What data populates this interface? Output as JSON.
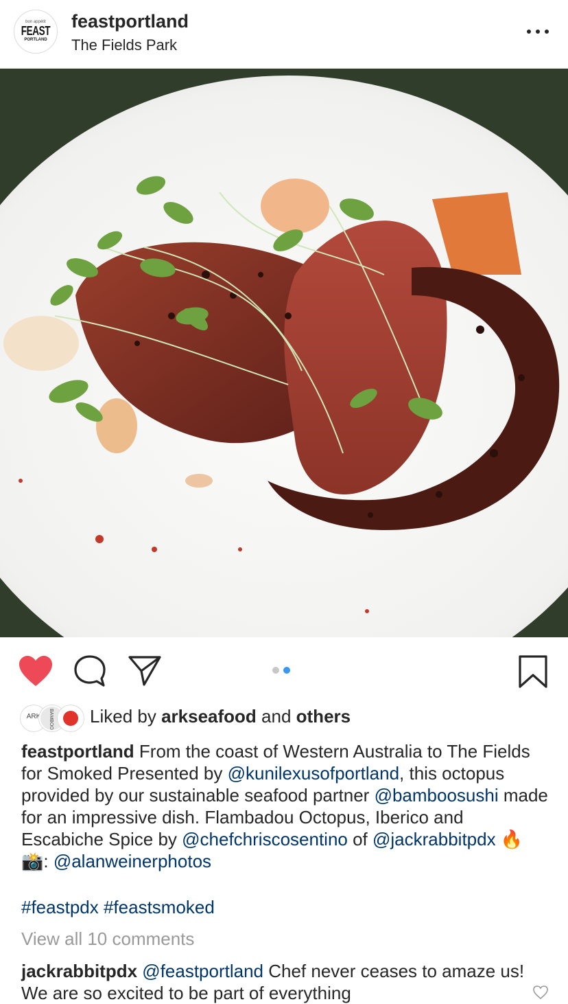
{
  "post": {
    "username": "feastportland",
    "location": "The Fields Park",
    "avatar": {
      "top": "bon appétit",
      "main": "FEAST",
      "bottom": "PORTLAND"
    }
  },
  "carousel": {
    "current": 2,
    "total": 2,
    "active_color": "#3897f0",
    "inactive_color": "#c7c7c7"
  },
  "actions": {
    "like_icon": "heart-filled-icon",
    "like_color": "#ed4956",
    "comment_icon": "comment-icon",
    "share_icon": "paper-plane-icon",
    "save_icon": "bookmark-icon"
  },
  "likes": {
    "prefix": "Liked by ",
    "user": "arkseafood",
    "connector": " and ",
    "others": "others",
    "avatars": [
      "ARK",
      "BAMBOO"
    ]
  },
  "caption": {
    "username": "feastportland",
    "text_1": " From the coast of Western Australia to The Fields for Smoked Presented by ",
    "mention_1": "@kunilexusofportland",
    "text_2": ", this octopus provided by our sustainable seafood partner ",
    "mention_2": "@bamboosushi",
    "text_3": " made for an impressive dish. Flambadou Octopus, Iberico and Escabiche Spice by ",
    "mention_3": "@chefchriscosentino",
    "text_4": " of ",
    "mention_4": "@jackrabbitpdx",
    "emoji_1": " 🔥 📸",
    "text_5": ": ",
    "mention_5": "@alanweinerphotos",
    "hashtags": "#feastpdx #feastsmoked"
  },
  "comments": {
    "view_all": "View all 10 comments",
    "first": {
      "username": "jackrabbitpdx",
      "mention": "@feastportland",
      "text": " Chef never ceases to amaze us! We are so excited to be part of everything"
    }
  }
}
